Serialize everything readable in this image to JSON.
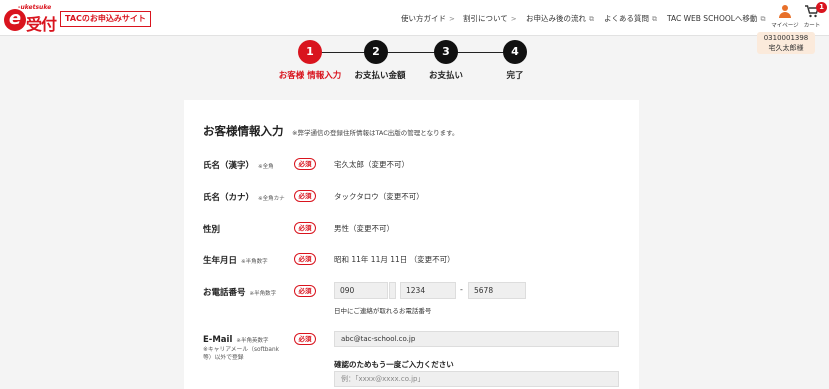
{
  "header": {
    "logo_sub": "-uketsuke",
    "logo_mark": "e",
    "logo_text": "受付",
    "site_tag": "TACのお申込みサイト",
    "nav": [
      {
        "label": "使い方ガイド",
        "icon": "chevron-right"
      },
      {
        "label": "割引について",
        "icon": "chevron-right"
      },
      {
        "label": "お申込み後の流れ",
        "icon": "external-link"
      },
      {
        "label": "よくある質問",
        "icon": "external-link"
      },
      {
        "label": "TAC WEB SCHOOLへ移動",
        "icon": "external-link"
      }
    ],
    "mypage_label": "マイページ",
    "cart_label": "カート",
    "cart_count": "1",
    "user_id": "0310001398",
    "user_name": "宅久太郎様"
  },
  "steps": [
    {
      "num": "1",
      "label": "お客様 情報入力",
      "active": true
    },
    {
      "num": "2",
      "label": "お支払い金額",
      "active": false
    },
    {
      "num": "3",
      "label": "お支払い",
      "active": false
    },
    {
      "num": "4",
      "label": "完了",
      "active": false
    }
  ],
  "form": {
    "title": "お客様情報入力",
    "note": "※弊学通信の登録住所情報はTAC出版の管理となります。",
    "required_label": "必須",
    "rows": {
      "name_kanji": {
        "label": "氏名（漢字）",
        "sub": "※全角",
        "value": "宅久太郎（変更不可）"
      },
      "name_kana": {
        "label": "氏名（カナ）",
        "sub": "※全角カナ",
        "value": "タックタロウ（変更不可）"
      },
      "gender": {
        "label": "性別",
        "value": "男性（変更不可）"
      },
      "birthday": {
        "label": "生年月日",
        "sub": "※半角数字",
        "value": "昭和 11年 11月 11日 （変更不可）"
      },
      "phone": {
        "label": "お電話番号",
        "sub": "※半角数字",
        "part1": "090",
        "part2": "1234",
        "part3": "5678",
        "dash": "-",
        "help": "日中にご連絡が取れるお電話番号"
      },
      "email": {
        "label": "E-Mail",
        "sub": "※半角英数字",
        "sub2": "※キャリアメール（softbank等）以外で登録",
        "value": "abc@tac-school.co.jp",
        "confirm_label": "確認のためもう一度ご入力ください",
        "confirm_placeholder": "例：「xxxx@xxxx.co.jp」"
      }
    }
  },
  "colors": {
    "accent": "#d9141e",
    "user_icon": "#e8702a",
    "user_card_bg": "#fbeadb",
    "page_bg": "#f4f4f4"
  }
}
